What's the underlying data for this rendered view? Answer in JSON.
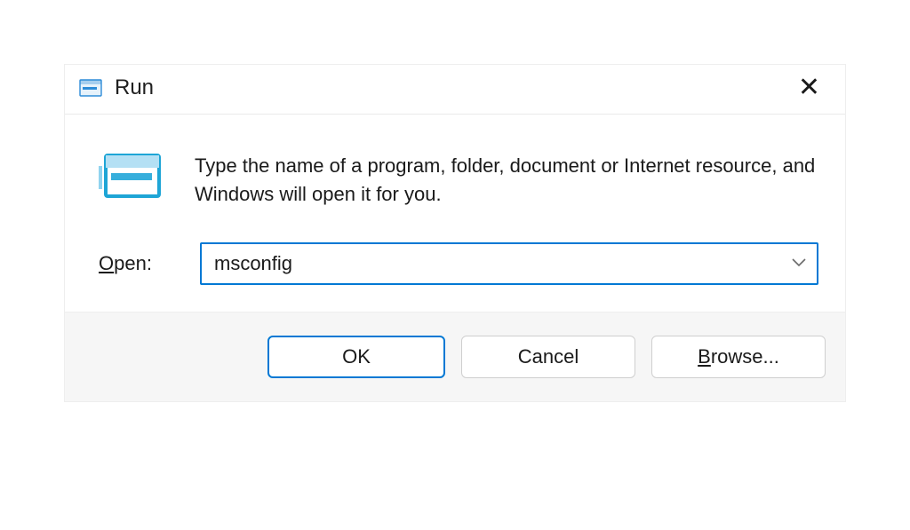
{
  "dialog": {
    "title": "Run",
    "description": "Type the name of a program, folder, document or Internet resource, and Windows will open it for you.",
    "open_label_prefix": "O",
    "open_label_rest": "pen:",
    "input_value": "msconfig",
    "buttons": {
      "ok": "OK",
      "cancel": "Cancel",
      "browse_prefix": "B",
      "browse_rest": "rowse..."
    }
  }
}
